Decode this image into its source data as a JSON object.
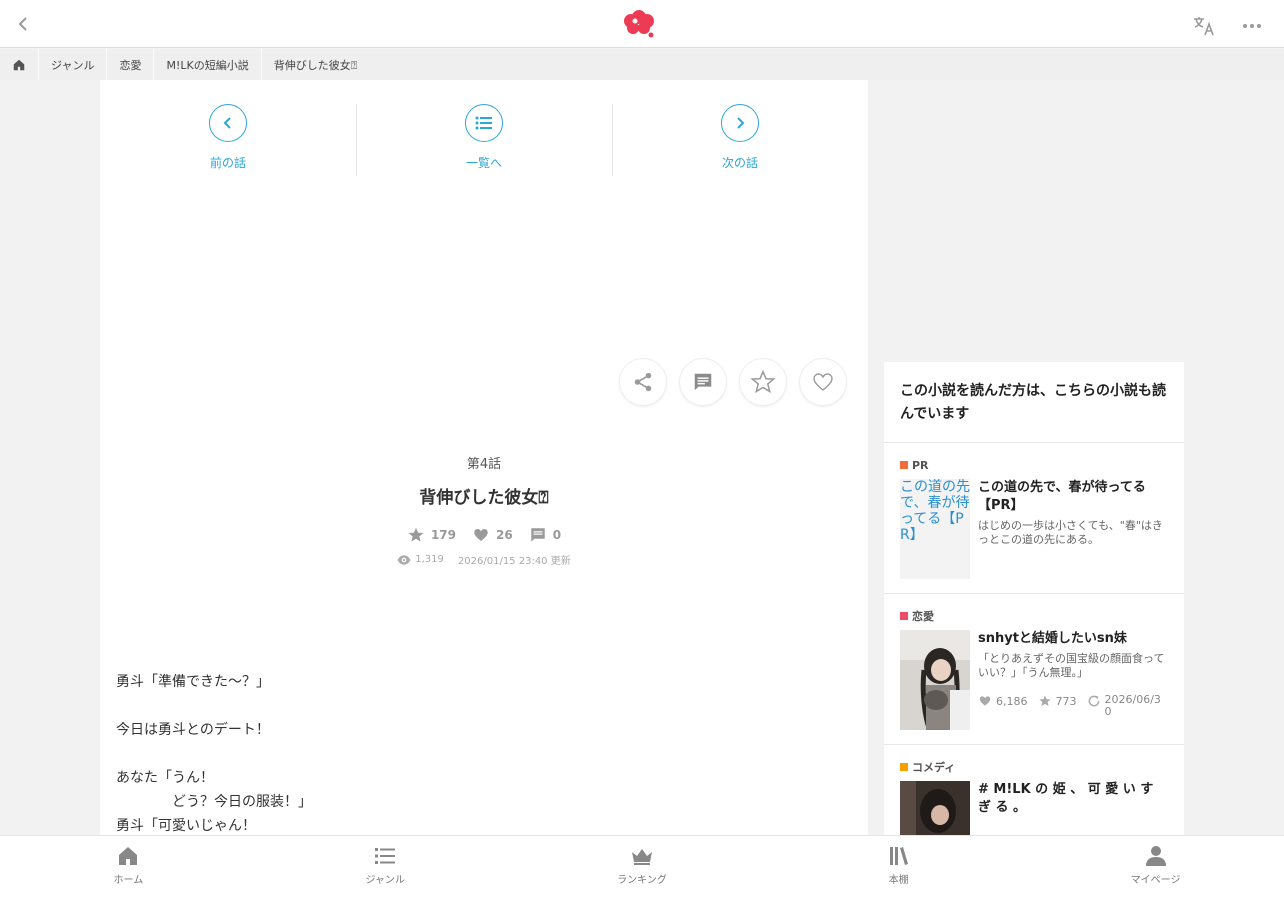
{
  "topbar": {
    "back_icon": "chevron-left-icon",
    "logo": "maho-logo",
    "translate_icon": "translate-icon",
    "more_icon": "more-icon"
  },
  "breadcrumb": {
    "home_icon": "home-icon",
    "items": [
      "ジャンル",
      "恋愛",
      "M!LKの短編小説",
      "背伸びした彼女⍰"
    ]
  },
  "nav": {
    "prev": "前の話",
    "list": "一覧へ",
    "next": "次の話"
  },
  "episode": {
    "number": "第4話",
    "title": "背伸びした彼女⍰",
    "stars": "179",
    "likes": "26",
    "comments": "0",
    "views": "1,319",
    "updated": "2026/01/15 23:40 更新"
  },
  "body": [
    "勇斗「準備できた〜？」",
    "",
    "今日は勇斗とのデート！",
    "",
    "あなた「うん！",
    "どう？今日の服装！」",
    "勇斗「可愛いじゃん！"
  ],
  "sidebar": {
    "heading": "この小説を読んだ方は、こちらの小説も読んでいます",
    "cards": [
      {
        "category": "PR",
        "category_color": "#f26b3a",
        "title": "この道の先で、春が待ってる【PR】",
        "thumb_alt": "この道の先で、春が待ってる【PR】",
        "desc": "はじめの一歩は小さくても、\"春\"はきっとこの道の先にある。"
      },
      {
        "category": "恋愛",
        "category_color": "#e94b6b",
        "title": "snhytと結婚したいsn妹",
        "desc": "「とりあえずその国宝級の顔面食っていい？」「うん無理。」",
        "likes": "6,186",
        "stars": "773",
        "date": "2026/06/30"
      },
      {
        "category": "コメディ",
        "category_color": "#f5a000",
        "title": "# M!LK の 姫 、 可 愛 い す ぎ る 。"
      }
    ]
  },
  "tabs": [
    "ホーム",
    "ジャンル",
    "ランキング",
    "本棚",
    "マイページ"
  ],
  "colors": {
    "accent": "#2aa7d4",
    "logo": "#ee3b55",
    "icon_gray": "#999999"
  }
}
